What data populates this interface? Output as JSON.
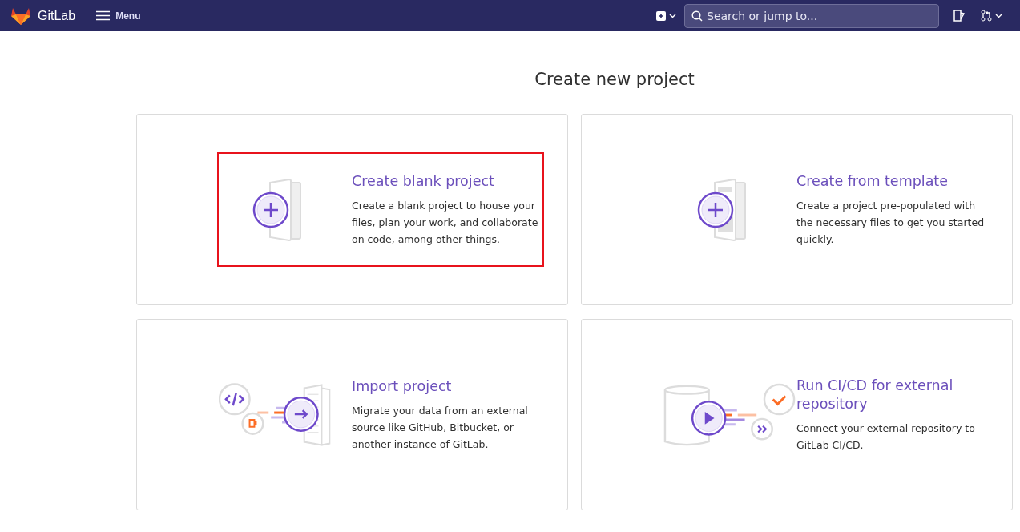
{
  "navbar": {
    "brand": "GitLab",
    "menu": "Menu",
    "search": {
      "placeholder": "Search or jump to..."
    }
  },
  "title": "Create new project",
  "cards": [
    {
      "kind": "blank",
      "title": "Create blank project",
      "description": "Create a blank project to house your files, plan your work, and collaborate on code, among other things.",
      "highlighted": true
    },
    {
      "kind": "template",
      "title": "Create from template",
      "description": "Create a project pre-populated with the necessary files to get you started quickly.",
      "highlighted": false
    },
    {
      "kind": "import",
      "title": "Import project",
      "description": "Migrate your data from an external source like GitHub, Bitbucket, or another instance of GitLab.",
      "highlighted": false
    },
    {
      "kind": "cicd",
      "title": "Run CI/CD for external repository",
      "description": "Connect your external repository to GitLab CI/CD.",
      "highlighted": false
    }
  ]
}
